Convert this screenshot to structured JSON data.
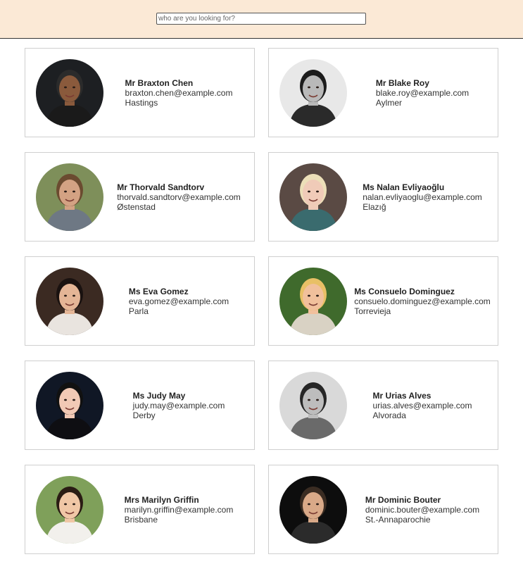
{
  "search": {
    "placeholder": "who are you looking for?",
    "value": ""
  },
  "users": [
    {
      "name": "Mr Braxton Chen",
      "email": "braxton.chen@example.com",
      "city": "Hastings",
      "avatar": {
        "bg": "#1d1f22",
        "skin": "#8a5a3c",
        "hair": "#2b2b2b",
        "shirt": "#1a1a1a",
        "grayscale": false
      }
    },
    {
      "name": "Mr Blake Roy",
      "email": "blake.roy@example.com",
      "city": "Aylmer",
      "avatar": {
        "bg": "#e8e8e8",
        "skin": "#b9b9b9",
        "hair": "#1c1c1c",
        "shirt": "#2a2a2a",
        "grayscale": true
      }
    },
    {
      "name": "Mr Thorvald Sandtorv",
      "email": "thorvald.sandtorv@example.com",
      "city": "Østenstad",
      "avatar": {
        "bg": "#7e8f5a",
        "skin": "#d3a283",
        "hair": "#6b4b30",
        "shirt": "#6e7884",
        "grayscale": false
      }
    },
    {
      "name": "Ms Nalan Evliyaoğlu",
      "email": "nalan.evliyaoglu@example.com",
      "city": "Elazığ",
      "avatar": {
        "bg": "#5a4a44",
        "skin": "#f0cbb8",
        "hair": "#ecdfb8",
        "shirt": "#3a6b6e",
        "grayscale": false
      }
    },
    {
      "name": "Ms Eva Gomez",
      "email": "eva.gomez@example.com",
      "city": "Parla",
      "avatar": {
        "bg": "#3b2a22",
        "skin": "#e4b596",
        "hair": "#1a1210",
        "shirt": "#e9e4df",
        "grayscale": false
      }
    },
    {
      "name": "Ms Consuelo Dominguez",
      "email": "consuelo.dominguez@example.com",
      "city": "Torrevieja",
      "avatar": {
        "bg": "#3f6a2c",
        "skin": "#f1c09c",
        "hair": "#e8c066",
        "shirt": "#d9d2c4",
        "grayscale": false
      }
    },
    {
      "name": "Ms Judy May",
      "email": "judy.may@example.com",
      "city": "Derby",
      "avatar": {
        "bg": "#101725",
        "skin": "#f1c9b5",
        "hair": "#111111",
        "shirt": "#0e0e12",
        "grayscale": false
      }
    },
    {
      "name": "Mr Urias Alves",
      "email": "urias.alves@example.com",
      "city": "Alvorada",
      "avatar": {
        "bg": "#d9d9d9",
        "skin": "#bdbdbd",
        "hair": "#262626",
        "shirt": "#6a6a6a",
        "grayscale": true
      }
    },
    {
      "name": "Mrs Marilyn Griffin",
      "email": "marilyn.griffin@example.com",
      "city": "Brisbane",
      "avatar": {
        "bg": "#7fa05a",
        "skin": "#f0c7a6",
        "hair": "#2a1c14",
        "shirt": "#f2f0ec",
        "grayscale": false
      }
    },
    {
      "name": "Mr Dominic Bouter",
      "email": "dominic.bouter@example.com",
      "city": "St.-Annaparochie",
      "avatar": {
        "bg": "#0d0d0d",
        "skin": "#d9a988",
        "hair": "#3a2c22",
        "shirt": "#2b2b2b",
        "grayscale": false
      }
    }
  ]
}
